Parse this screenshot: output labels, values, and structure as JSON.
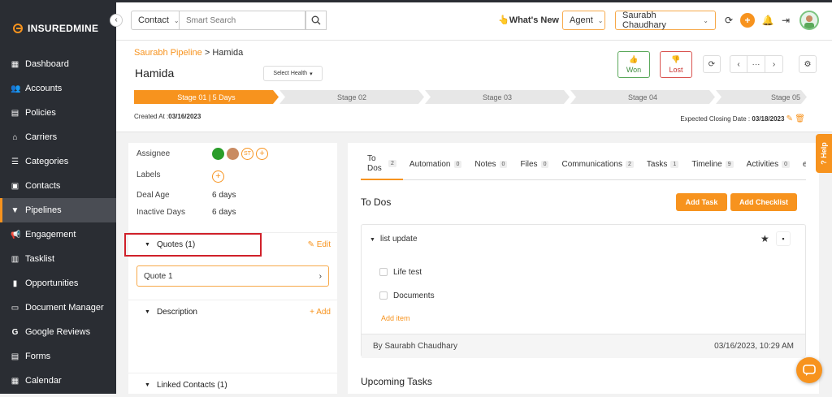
{
  "brand": {
    "name": "INSUREDMINE",
    "accent": "#f7931e"
  },
  "sidebar": {
    "items": [
      {
        "label": "Dashboard",
        "icon": "dashboard-icon"
      },
      {
        "label": "Accounts",
        "icon": "accounts-icon"
      },
      {
        "label": "Policies",
        "icon": "policies-icon"
      },
      {
        "label": "Carriers",
        "icon": "carriers-icon"
      },
      {
        "label": "Categories",
        "icon": "categories-icon"
      },
      {
        "label": "Contacts",
        "icon": "contacts-icon"
      },
      {
        "label": "Pipelines",
        "icon": "pipelines-icon",
        "active": true
      },
      {
        "label": "Engagement",
        "icon": "engagement-icon"
      },
      {
        "label": "Tasklist",
        "icon": "tasklist-icon"
      },
      {
        "label": "Opportunities",
        "icon": "opportunities-icon"
      },
      {
        "label": "Document Manager",
        "icon": "folder-icon"
      },
      {
        "label": "Google Reviews",
        "icon": "google-icon"
      },
      {
        "label": "Forms",
        "icon": "forms-icon"
      },
      {
        "label": "Calendar",
        "icon": "calendar-icon"
      }
    ]
  },
  "topbar": {
    "contact_select": "Contact",
    "search_placeholder": "Smart Search",
    "whats_new": "What's New",
    "role_select": "Agent",
    "user_select": "Saurabh Chaudhary"
  },
  "header": {
    "breadcrumb_parent": "Saurabh Pipeline",
    "breadcrumb_sep": ">",
    "breadcrumb_current": "Hamida",
    "title": "Hamida",
    "health_select": "Select Health",
    "won_label": "Won",
    "lost_label": "Lost",
    "stages": [
      "Stage 01 | 5 Days",
      "Stage 02",
      "Stage 03",
      "Stage 04",
      "Stage 05"
    ],
    "created_label": "Created At :",
    "created_value": "03/16/2023",
    "closing_label": "Expected Closing Date :",
    "closing_value": "03/18/2023"
  },
  "details": {
    "assignee_label": "Assignee",
    "assignee_initials": "ST",
    "labels_label": "Labels",
    "deal_age_label": "Deal Age",
    "deal_age_value": "6 days",
    "inactive_label": "Inactive Days",
    "inactive_value": "6 days",
    "quotes_label": "Quotes (1)",
    "edit_label": "Edit",
    "quote_item": "Quote 1",
    "description_label": "Description",
    "add_label": "Add",
    "linked_label": "Linked Contacts (1)"
  },
  "tabs": [
    {
      "label": "To Dos",
      "count": "2",
      "active": true
    },
    {
      "label": "Automation",
      "count": "0"
    },
    {
      "label": "Notes",
      "count": "0"
    },
    {
      "label": "Files",
      "count": "0"
    },
    {
      "label": "Communications",
      "count": "2"
    },
    {
      "label": "Tasks",
      "count": "1"
    },
    {
      "label": "Timeline",
      "count": "9"
    },
    {
      "label": "Activities",
      "count": "0"
    },
    {
      "label": "eSig",
      "count": ""
    }
  ],
  "todos": {
    "title": "To Dos",
    "add_task": "Add Task",
    "add_checklist": "Add Checklist",
    "list_name": "list update",
    "items": [
      "Life test",
      "Documents"
    ],
    "add_item": "Add item",
    "by": "By Saurabh Chaudhary",
    "timestamp": "03/16/2023, 10:29 AM",
    "upcoming": "Upcoming Tasks"
  },
  "help_label": "Help"
}
